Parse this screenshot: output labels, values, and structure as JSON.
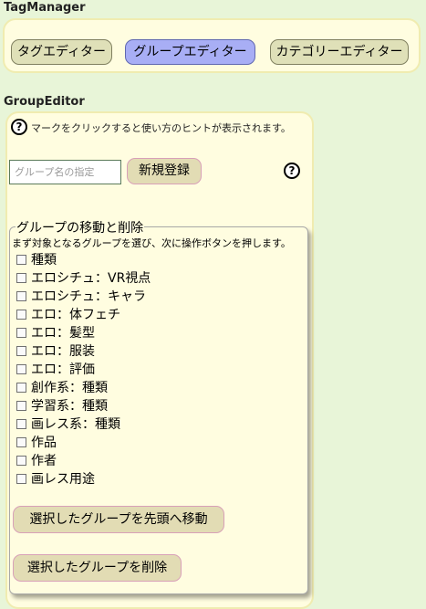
{
  "tag_manager": {
    "title": "TagManager",
    "tabs": [
      {
        "label": "タグエディター",
        "active": false
      },
      {
        "label": "グループエディター",
        "active": true
      },
      {
        "label": "カテゴリーエディター",
        "active": false
      }
    ]
  },
  "group_editor": {
    "title": "GroupEditor",
    "hint_text": "マークをクリックすると使い方のヒントが表示されます。",
    "name_input": {
      "placeholder": "グループ名の指定",
      "value": ""
    },
    "register_label": "新規登録",
    "help_icon_glyph": "?",
    "move_delete": {
      "legend": "グループの移動と削除",
      "instruction": "まず対象となるグループを選び、次に操作ボタンを押します。",
      "groups": [
        "種類",
        "エロシチュ：VR視点",
        "エロシチュ：キャラ",
        "エロ：体フェチ",
        "エロ：髪型",
        "エロ：服装",
        "エロ：評価",
        "創作系：種類",
        "学習系：種類",
        "画レス系：種類",
        "作品",
        "作者",
        "画レス用途"
      ],
      "move_top_label": "選択したグループを先頭へ移動",
      "delete_label": "選択したグループを削除"
    }
  },
  "colors": {
    "page_bg": "#e8f5d8",
    "panel_bg": "#fffde0",
    "active_tab": "#a8aef5",
    "button_bg": "#e2dcb4"
  }
}
